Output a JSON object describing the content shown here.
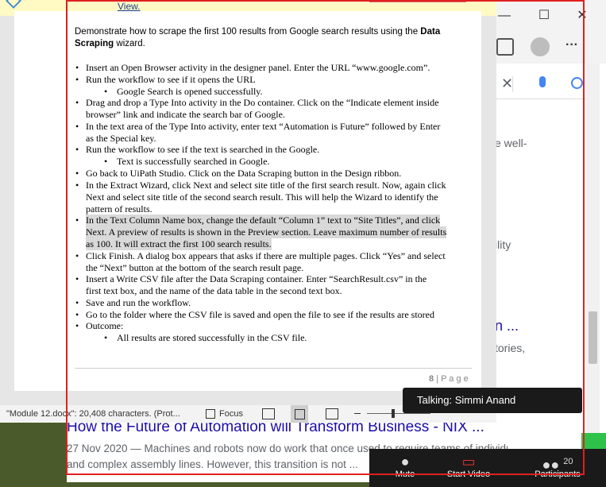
{
  "browser": {
    "minimize": "—",
    "restore": "☐",
    "close": "✕",
    "more": "···",
    "clear": "✕",
    "snippet1": "e well-",
    "snippet2": "ility",
    "snippet3": "n ...",
    "snippet4": "tories,"
  },
  "banner": {
    "link": "View."
  },
  "document": {
    "intro_plain": "Demonstrate how to scrape the first 100 results from Google search results using the ",
    "intro_bold": "Data Scraping",
    "intro_end": " wizard.",
    "bullets": [
      "Insert an Open Browser activity in the designer panel. Enter the URL “www.google.com”.",
      "Run the workflow to see if it opens the URL",
      "Google Search is opened successfully.",
      "Drag and drop a Type Into activity in the Do container. Click on the “Indicate element inside",
      "browser” link and indicate the search bar of Google.",
      "In the text area of the Type Into activity, enter text “Automation is Future” followed by Enter",
      "as the Special key.",
      "Run the workflow to see if the text is searched in the Google.",
      "Text is successfully searched in Google.",
      "Go back to UiPath Studio. Click on the Data Scraping button in the Design ribbon.",
      "In the Extract Wizard, click Next and select site title of the first search result. Now, again click",
      "Next and select site title of the second search result. This will help the Wizard to identify the",
      "pattern of results.",
      "In the Text Column Name box, change the default “Column 1” text to “Site Titles”, and click",
      "Next. A preview of results is shown in the Preview section. Leave maximum number of results",
      "as 100. It will extract the first 100 search results.",
      "Click Finish. A dialog box appears that asks if there are multiple pages. Click “Yes” and select",
      "the “Next” button at the bottom of the search result page.",
      "Insert a Write CSV file after the Data Scraping container. Enter “SearchResult.csv” in the",
      "first text box, and the name of the data table in the second text box.",
      "Save and run the workflow.",
      "Go to the folder where the CSV file is saved and open the file to see if the results are stored",
      "Outcome:",
      "All results are stored successfully in the CSV file."
    ],
    "page_num": "8",
    "page_label": "| P a g e"
  },
  "status": {
    "info": "\"Module 12.docx\": 20,408 characters.  (Prot...",
    "focus": "Focus"
  },
  "serp": {
    "title": "How the Future of Automation will Transform Business - NIX ...",
    "line1": "27 Nov 2020 — Machines and robots now do work that once used to require teams of individuals",
    "line2": "and complex assembly lines. However, this transition is not ..."
  },
  "zoom": {
    "talking": "Talking: Simmi Anand",
    "mute": "Mute",
    "start_video": "Start Video",
    "participants": "Participants",
    "participants_count": "20"
  }
}
